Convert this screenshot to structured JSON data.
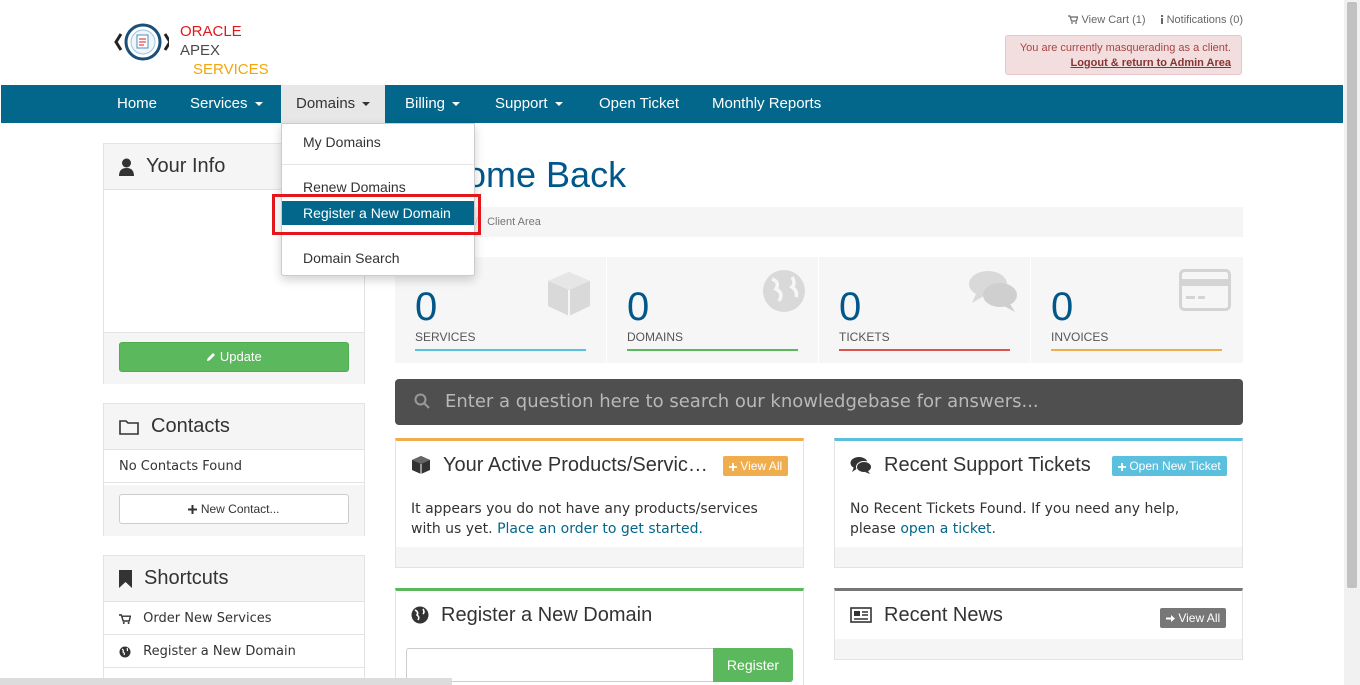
{
  "brand": {
    "line1a": "ORACLE",
    "line1b": "APEX",
    "line2": "SERVICES"
  },
  "top_links": {
    "cart": "View Cart (1)",
    "notifications": "Notifications (0)"
  },
  "masquerade": {
    "message": "You are currently masquerading as a client.",
    "logout": "Logout & return to Admin Area"
  },
  "nav": [
    {
      "label": "Home"
    },
    {
      "label": "Services"
    },
    {
      "label": "Domains"
    },
    {
      "label": "Billing"
    },
    {
      "label": "Support"
    },
    {
      "label": "Open Ticket"
    },
    {
      "label": "Monthly Reports"
    }
  ],
  "domains_menu": {
    "items": [
      "My Domains",
      "Renew Domains",
      "Register a New Domain",
      "Domain Search"
    ]
  },
  "sidebar": {
    "your_info": {
      "title": "Your Info",
      "update": "Update"
    },
    "contacts": {
      "title": "Contacts",
      "empty": "No Contacts Found",
      "new_contact": "New Contact..."
    },
    "shortcuts": {
      "title": "Shortcuts",
      "items": [
        "Order New Services",
        "Register a New Domain"
      ]
    }
  },
  "main": {
    "welcome": "ome Back",
    "breadcrumb": {
      "current": "Client Area"
    },
    "stats": [
      {
        "value": "0",
        "label": "SERVICES",
        "color": "#5bc0de"
      },
      {
        "value": "0",
        "label": "DOMAINS",
        "color": "#5cb85c"
      },
      {
        "value": "0",
        "label": "TICKETS",
        "color": "#d9534f"
      },
      {
        "value": "0",
        "label": "INVOICES",
        "color": "#f0ad4e"
      }
    ],
    "kb_placeholder": "Enter a question here to search our knowledgebase for answers...",
    "products": {
      "title": "Your Active Products/Servic…",
      "button": "View All",
      "text": "It appears you do not have any products/services with us yet.",
      "link": "Place an order to get started."
    },
    "tickets": {
      "title": "Recent Support Tickets",
      "button": "Open New Ticket",
      "text": "No Recent Tickets Found. If you need any help, please",
      "link": "open a ticket."
    },
    "register": {
      "title": "Register a New Domain",
      "button": "Register"
    },
    "news": {
      "title": "Recent News",
      "button": "View All"
    }
  }
}
